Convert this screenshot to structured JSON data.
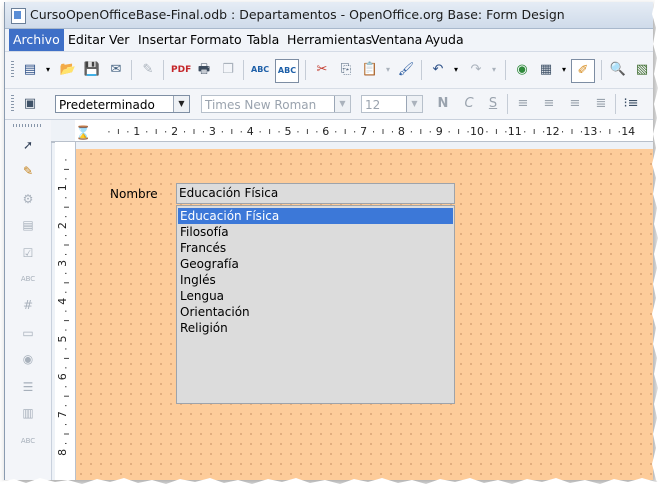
{
  "window": {
    "title": "CursoOpenOfficeBase-Final.odb : Departamentos - OpenOffice.org Base: Form Design"
  },
  "menubar": {
    "items": [
      "Archivo",
      "Editar",
      "Ver",
      "Insertar",
      "Formato",
      "Tabla",
      "Herramientas",
      "Ventana",
      "Ayuda"
    ]
  },
  "format_toolbar": {
    "paragraph_style": "Predeterminado",
    "font_name": "Times New Roman",
    "font_size": "12"
  },
  "ruler": {
    "horizontal_ticks": [
      "1",
      "2",
      "3",
      "4",
      "5",
      "6",
      "7",
      "8",
      "9",
      "10",
      "11",
      "12",
      "13",
      "14"
    ],
    "vertical_ticks": [
      "1",
      "2",
      "3",
      "4",
      "5",
      "6",
      "7",
      "8"
    ]
  },
  "form": {
    "field_label": "Nombre",
    "selected_value": "Educación Física",
    "options": [
      "Educación Física",
      "Filosofía",
      "Francés",
      "Geografía",
      "Inglés",
      "Lengua",
      "Orientación",
      "Religión"
    ],
    "selected_index": 0
  },
  "colors": {
    "canvas": "#fdcc9a",
    "selection": "#3c78d8",
    "menu_active": "#3e6fc7"
  }
}
